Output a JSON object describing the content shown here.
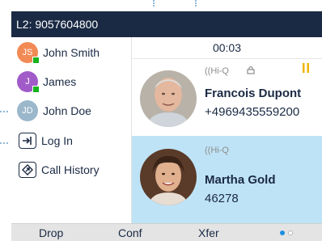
{
  "status_bar": {
    "line_label": "L2: 9057604800"
  },
  "sidebar": {
    "items": [
      {
        "type": "contact",
        "label": "John Smith",
        "initials": "JS",
        "avatar_color": "#f28a55",
        "presence": true
      },
      {
        "type": "contact",
        "label": "James",
        "initials": "J",
        "avatar_color": "#a15bc8",
        "presence": true
      },
      {
        "type": "contact",
        "label": "John Doe",
        "initials": "JD",
        "avatar_color": "#9bb7cb",
        "presence": false
      },
      {
        "type": "action",
        "label": "Log In",
        "icon": "login-icon"
      },
      {
        "type": "action",
        "label": "Call History",
        "icon": "call-history-icon"
      }
    ]
  },
  "main": {
    "timer": "00:03",
    "calls": [
      {
        "codec": "Hi-Q",
        "name": "Francois Dupont",
        "number": "+4969435559200",
        "secure": true,
        "on_hold": true,
        "active": false
      },
      {
        "codec": "Hi-Q",
        "name": "Martha Gold",
        "number": "46278",
        "secure": false,
        "on_hold": false,
        "active": true
      }
    ]
  },
  "softkeys": {
    "drop": "Drop",
    "conf": "Conf",
    "xfer": "Xfer",
    "page_indicator": {
      "pages": 2,
      "current": 1
    }
  },
  "colors": {
    "header_bg": "#1a2a44",
    "active_call_bg": "#bfe3f6",
    "presence_green": "#17b31c",
    "hold_icon": "#f0b400",
    "page_dot_active": "#1f8fe0"
  }
}
